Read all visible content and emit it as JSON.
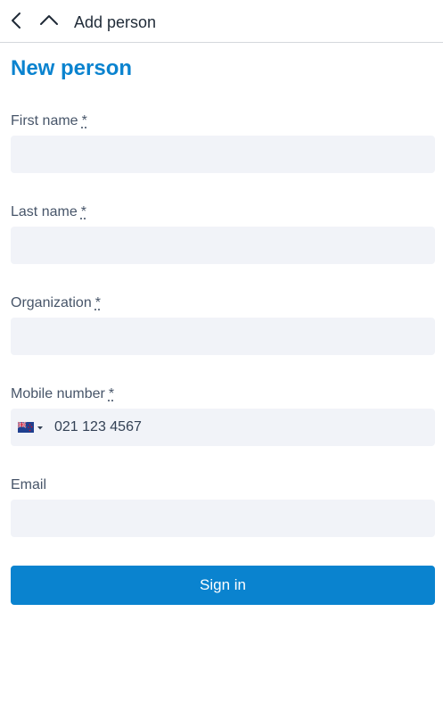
{
  "topbar": {
    "title": "Add person",
    "back_icon": "chevron-left-icon",
    "up_icon": "chevron-up-icon"
  },
  "page_title": "New person",
  "required_marker": "*",
  "fields": {
    "first_name": {
      "label": "First name",
      "value": ""
    },
    "last_name": {
      "label": "Last name",
      "value": ""
    },
    "organization": {
      "label": "Organization",
      "value": ""
    },
    "mobile": {
      "label": "Mobile number",
      "country": "NZ",
      "flag_icon": "new-zealand-flag-icon",
      "placeholder": "021 123 4567"
    },
    "email": {
      "label": "Email",
      "value": ""
    }
  },
  "submit_label": "Sign in",
  "colors": {
    "accent": "#0a83cf",
    "input_bg": "#f1f3f8",
    "label": "#475569"
  }
}
